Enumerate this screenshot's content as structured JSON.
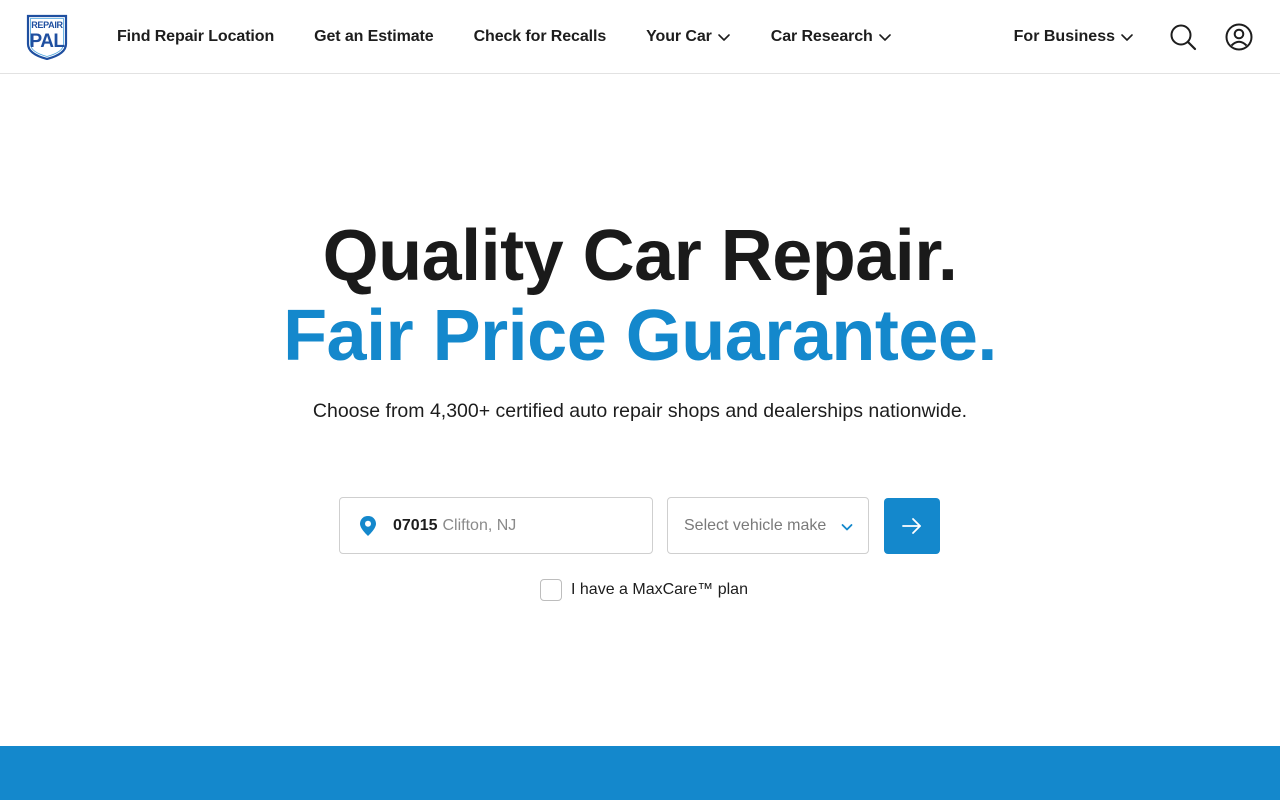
{
  "brand": {
    "logo_line1": "REPAIR",
    "logo_line2": "PAL",
    "accent_color": "#1488cc",
    "logo_blue": "#1f4fa0"
  },
  "nav": {
    "items": [
      {
        "label": "Find Repair Location",
        "dropdown": false
      },
      {
        "label": "Get an Estimate",
        "dropdown": false
      },
      {
        "label": "Check for Recalls",
        "dropdown": false
      },
      {
        "label": "Your Car",
        "dropdown": true
      },
      {
        "label": "Car Research",
        "dropdown": true
      }
    ],
    "business_label": "For Business",
    "search_icon": "search-icon",
    "account_icon": "user-circle-icon"
  },
  "hero": {
    "title_line1": "Quality Car Repair.",
    "title_line2": "Fair Price Guarantee.",
    "subtitle": "Choose from 4,300+ certified auto repair shops and dealerships nationwide."
  },
  "search": {
    "zip": "07015",
    "city": "Clifton, NJ",
    "make_placeholder": "Select vehicle make",
    "submit_icon": "arrow-right-icon",
    "maxcare_label": "I have a MaxCare™ plan",
    "maxcare_checked": false
  }
}
